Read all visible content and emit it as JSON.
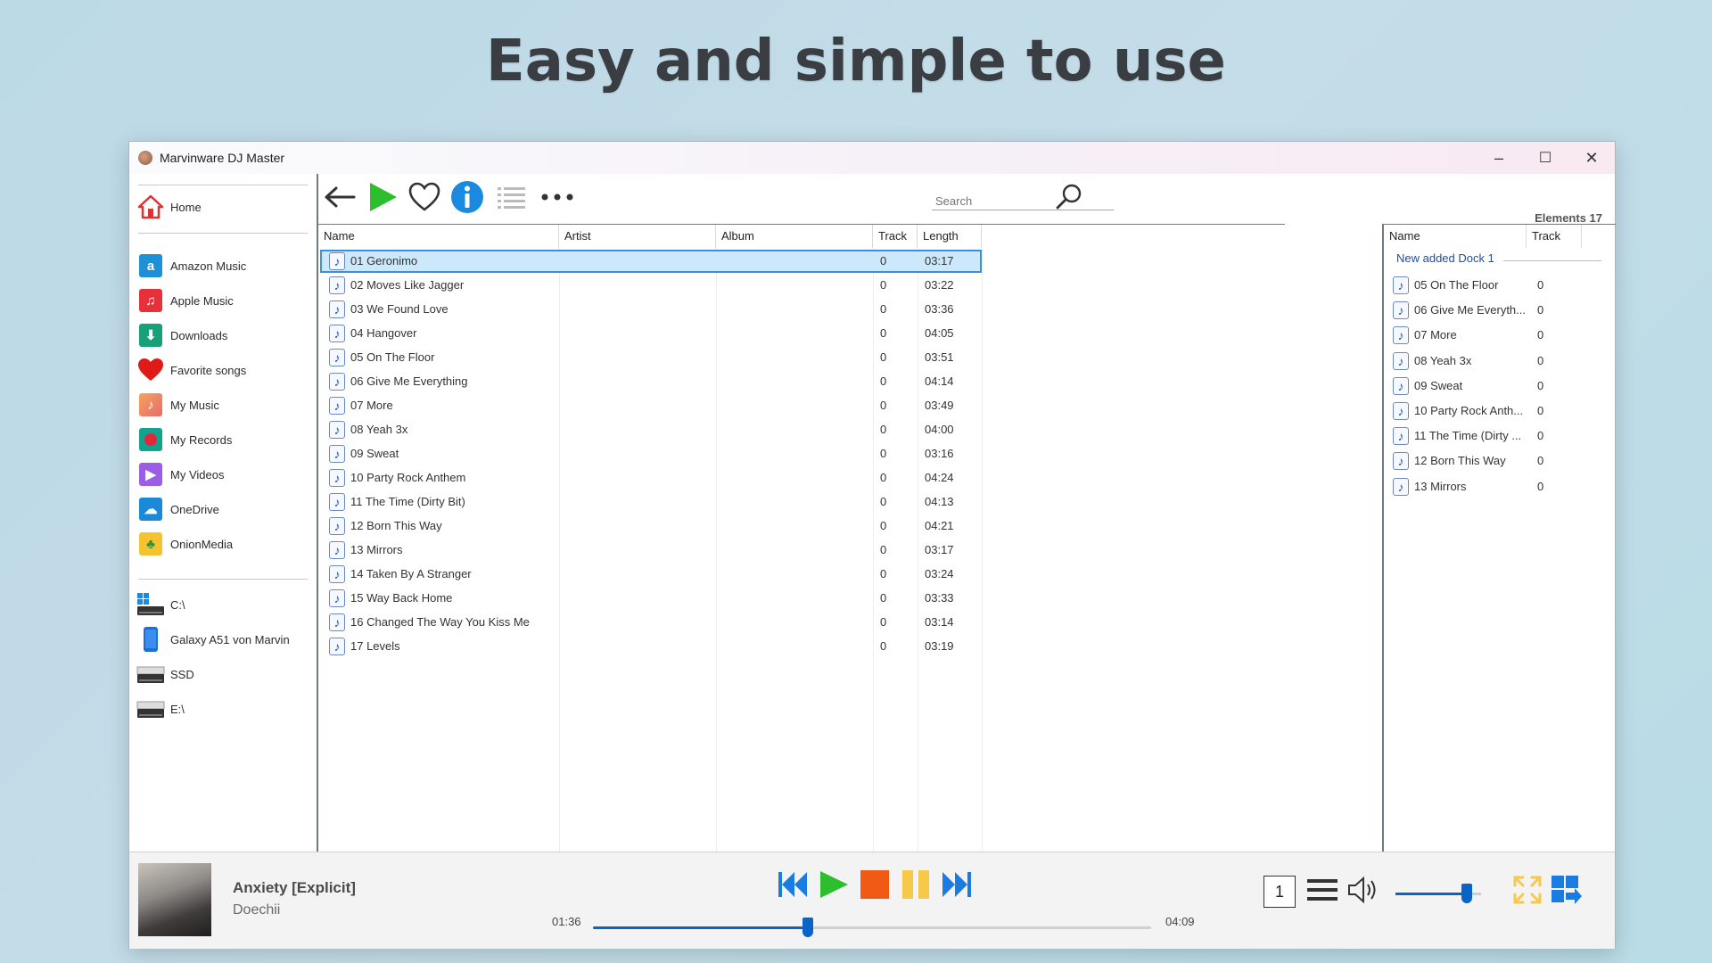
{
  "headline": "Easy and simple to use",
  "window": {
    "title": "Marvinware DJ Master",
    "minimize": "–",
    "maximize": "☐",
    "close": "✕"
  },
  "sidebar": {
    "home": "Home",
    "items": [
      {
        "label": "Amazon Music",
        "icon": "amazon-music-icon",
        "color": "#1e90d6"
      },
      {
        "label": "Apple Music",
        "icon": "apple-music-icon",
        "color": "#e8303a"
      },
      {
        "label": "Downloads",
        "icon": "downloads-icon",
        "color": "#18a078"
      },
      {
        "label": "Favorite songs",
        "icon": "heart-icon",
        "color": "#e01919"
      },
      {
        "label": "My Music",
        "icon": "music-folder-icon",
        "color": "#f07a45"
      },
      {
        "label": "My Records",
        "icon": "records-icon",
        "color": "#12a38e"
      },
      {
        "label": "My Videos",
        "icon": "videos-icon",
        "color": "#9b5de5"
      },
      {
        "label": "OneDrive",
        "icon": "onedrive-icon",
        "color": "#1a8ad8"
      },
      {
        "label": "OnionMedia",
        "icon": "onionmedia-icon",
        "color": "#f4c430"
      }
    ],
    "drives": [
      {
        "label": "C:\\",
        "icon": "windows-drive-icon"
      },
      {
        "label": "Galaxy A51 von Marvin",
        "icon": "phone-icon"
      },
      {
        "label": "SSD",
        "icon": "drive-icon"
      },
      {
        "label": "E:\\",
        "icon": "drive-icon"
      }
    ]
  },
  "toolbar": {
    "search_placeholder": "Search",
    "elements": "Elements 17"
  },
  "columns": {
    "name": "Name",
    "artist": "Artist",
    "album": "Album",
    "track": "Track",
    "length": "Length"
  },
  "tracks": [
    {
      "name": "01 Geronimo",
      "artist": "",
      "album": "",
      "track": "0",
      "length": "03:17"
    },
    {
      "name": "02 Moves Like Jagger",
      "artist": "",
      "album": "",
      "track": "0",
      "length": "03:22"
    },
    {
      "name": "03 We Found Love",
      "artist": "",
      "album": "",
      "track": "0",
      "length": "03:36"
    },
    {
      "name": "04 Hangover",
      "artist": "",
      "album": "",
      "track": "0",
      "length": "04:05"
    },
    {
      "name": "05 On The Floor",
      "artist": "",
      "album": "",
      "track": "0",
      "length": "03:51"
    },
    {
      "name": "06 Give Me Everything",
      "artist": "",
      "album": "",
      "track": "0",
      "length": "04:14"
    },
    {
      "name": "07 More",
      "artist": "",
      "album": "",
      "track": "0",
      "length": "03:49"
    },
    {
      "name": "08 Yeah 3x",
      "artist": "",
      "album": "",
      "track": "0",
      "length": "04:00"
    },
    {
      "name": "09 Sweat",
      "artist": "",
      "album": "",
      "track": "0",
      "length": "03:16"
    },
    {
      "name": "10 Party Rock Anthem",
      "artist": "",
      "album": "",
      "track": "0",
      "length": "04:24"
    },
    {
      "name": "11 The Time (Dirty Bit)",
      "artist": "",
      "album": "",
      "track": "0",
      "length": "04:13"
    },
    {
      "name": "12 Born This Way",
      "artist": "",
      "album": "",
      "track": "0",
      "length": "04:21"
    },
    {
      "name": "13 Mirrors",
      "artist": "",
      "album": "",
      "track": "0",
      "length": "03:17"
    },
    {
      "name": "14 Taken By A Stranger",
      "artist": "",
      "album": "",
      "track": "0",
      "length": "03:24"
    },
    {
      "name": "15 Way Back Home",
      "artist": "",
      "album": "",
      "track": "0",
      "length": "03:33"
    },
    {
      "name": "16 Changed The Way You Kiss Me",
      "artist": "",
      "album": "",
      "track": "0",
      "length": "03:14"
    },
    {
      "name": "17 Levels",
      "artist": "",
      "album": "",
      "track": "0",
      "length": "03:19"
    }
  ],
  "dock": {
    "columns": {
      "name": "Name",
      "track": "Track"
    },
    "group": "New added Dock 1",
    "items": [
      {
        "name": "05 On The Floor",
        "track": "0"
      },
      {
        "name": "06 Give Me Everyth...",
        "track": "0"
      },
      {
        "name": "07 More",
        "track": "0"
      },
      {
        "name": "08 Yeah 3x",
        "track": "0"
      },
      {
        "name": "09 Sweat",
        "track": "0"
      },
      {
        "name": "10 Party Rock Anth...",
        "track": "0"
      },
      {
        "name": "11 The Time (Dirty ...",
        "track": "0"
      },
      {
        "name": "12 Born This Way",
        "track": "0"
      },
      {
        "name": "13 Mirrors",
        "track": "0"
      }
    ]
  },
  "player": {
    "title": "Anxiety [Explicit]",
    "artist": "Doechii",
    "current_time": "01:36",
    "total_time": "04:09",
    "progress_fraction": 0.385,
    "volume_fraction": 0.83,
    "queue_number": "1",
    "accent": "#0a64c8"
  }
}
